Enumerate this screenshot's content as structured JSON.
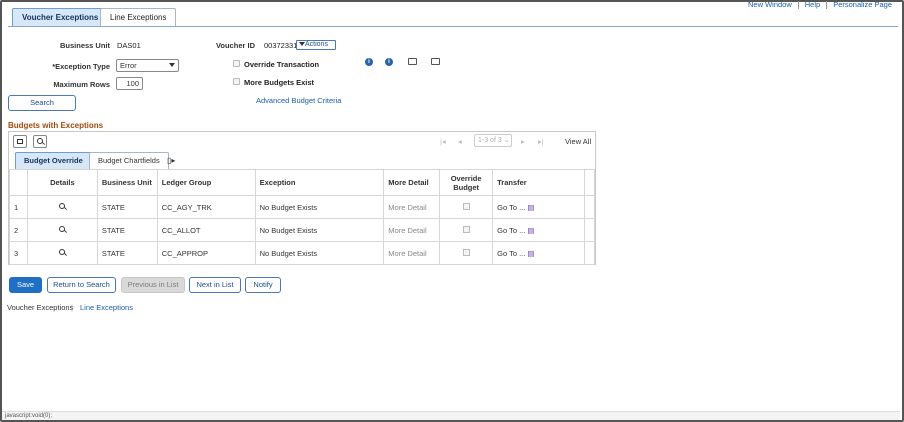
{
  "header_links": [
    "New Window",
    "Help",
    "Personalize Page"
  ],
  "tabs": [
    "Voucher Exceptions",
    "Line Exceptions"
  ],
  "form": {
    "business_unit_label": "Business Unit",
    "business_unit_value": "DAS01",
    "voucher_id_label": "Voucher ID",
    "voucher_id_value": "00372331",
    "actions_label": "Actions",
    "exception_type_label": "*Exception Type",
    "exception_type_value": "Error",
    "max_rows_label": "Maximum Rows",
    "max_rows_value": "100",
    "override_transaction_label": "Override Transaction",
    "more_budgets_exist_label": "More Budgets Exist",
    "advanced_budget_link": "Advanced Budget Criteria",
    "search_button": "Search"
  },
  "grid": {
    "section_title": "Budgets with Exceptions",
    "pager_text": "1-3 of 3",
    "view_all": "View All",
    "subtabs": [
      "Budget Override",
      "Budget Chartfields"
    ],
    "columns": [
      "Details",
      "Business Unit",
      "Ledger Group",
      "Exception",
      "More Detail",
      "Override Budget",
      "Transfer"
    ],
    "rows": [
      {
        "num": "1",
        "bu": "STATE",
        "ledger": "CC_AGY_TRK",
        "exception": "No Budget Exists",
        "more": "More Detail",
        "transfer": "Go To ..."
      },
      {
        "num": "2",
        "bu": "STATE",
        "ledger": "CC_ALLOT",
        "exception": "No Budget Exists",
        "more": "More Detail",
        "transfer": "Go To ..."
      },
      {
        "num": "3",
        "bu": "STATE",
        "ledger": "CC_APPROP",
        "exception": "No Budget Exists",
        "more": "More Detail",
        "transfer": "Go To ..."
      }
    ]
  },
  "buttons": {
    "save": "Save",
    "return": "Return to Search",
    "previous": "Previous in List",
    "next": "Next in List",
    "notify": "Notify"
  },
  "footer_links": [
    "Voucher Exceptions",
    "Line Exceptions"
  ],
  "status_bar": "javascript:void(0);",
  "colors": {
    "accent": "#1f6fc4",
    "section_title": "#a24c0e",
    "tab_active": "#d6e8f8"
  }
}
